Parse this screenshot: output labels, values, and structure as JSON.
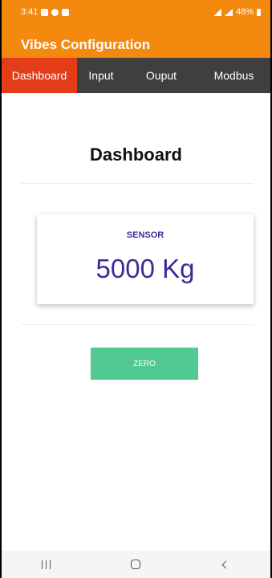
{
  "status_bar": {
    "time": "3:41",
    "battery": "48%"
  },
  "app": {
    "title": "Vibes Configuration"
  },
  "tabs": [
    {
      "label": "Dashboard",
      "active": true
    },
    {
      "label": "Input",
      "active": false
    },
    {
      "label": "Ouput",
      "active": false
    },
    {
      "label": "Modbus",
      "active": false
    }
  ],
  "dashboard": {
    "title": "Dashboard",
    "sensor_label": "SENSOR",
    "sensor_value": "5000 Kg",
    "zero_label": "ZERO"
  },
  "colors": {
    "header": "#f4890f",
    "tab_bar": "#3f3f3f",
    "tab_active": "#e23c18",
    "sensor_text": "#3b2c9a",
    "zero_button": "#52c990"
  },
  "nav_icons": [
    "recent-apps-icon",
    "home-icon",
    "back-icon"
  ]
}
